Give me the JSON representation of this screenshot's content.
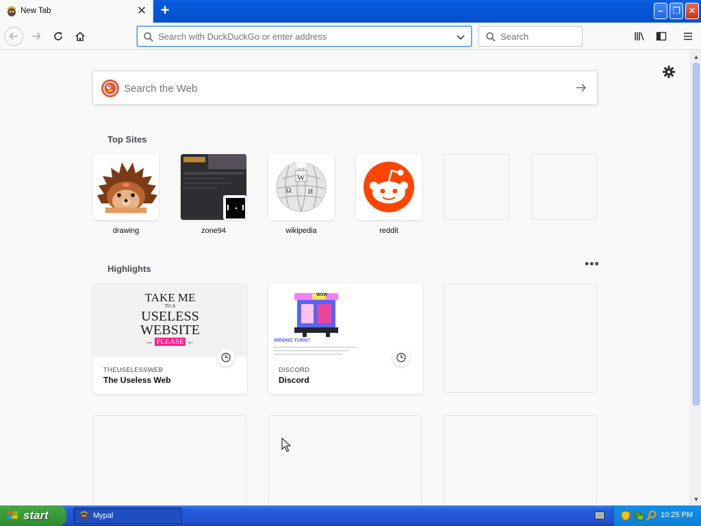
{
  "browser": {
    "tab": {
      "title": "New Tab"
    },
    "urlbar": {
      "placeholder": "Search with DuckDuckGo or enter address"
    },
    "searchbar": {
      "placeholder": "Search"
    }
  },
  "newtab": {
    "web_search": {
      "placeholder": "Search the Web"
    },
    "top_sites": {
      "title": "Top Sites",
      "items": [
        {
          "label": "drawing"
        },
        {
          "label": "zone94"
        },
        {
          "label": "wikipedia"
        },
        {
          "label": "reddit"
        },
        {
          "label": ""
        },
        {
          "label": ""
        }
      ]
    },
    "highlights": {
      "title": "Highlights",
      "cards": [
        {
          "host": "THEUSELESSWEB",
          "title": "The Useless Web",
          "thumb": {
            "line1": "TAKE ME",
            "line2": "TO A",
            "line3": "USELESS",
            "line4": "WEBSITE",
            "button": "PLEASE"
          }
        },
        {
          "host": "DISCORD",
          "title": "Discord",
          "thumb": {
            "heading": "WRONG TURN?",
            "sign": "WOW"
          }
        }
      ]
    }
  },
  "taskbar": {
    "start_label": "start",
    "task_label": "Mypal",
    "clock": "10:25 PM"
  },
  "colors": {
    "accent_blue": "#0a5fe0",
    "reddit": "#ff4500",
    "duckduckgo": "#de5833",
    "start_green": "#3a9d3a"
  }
}
